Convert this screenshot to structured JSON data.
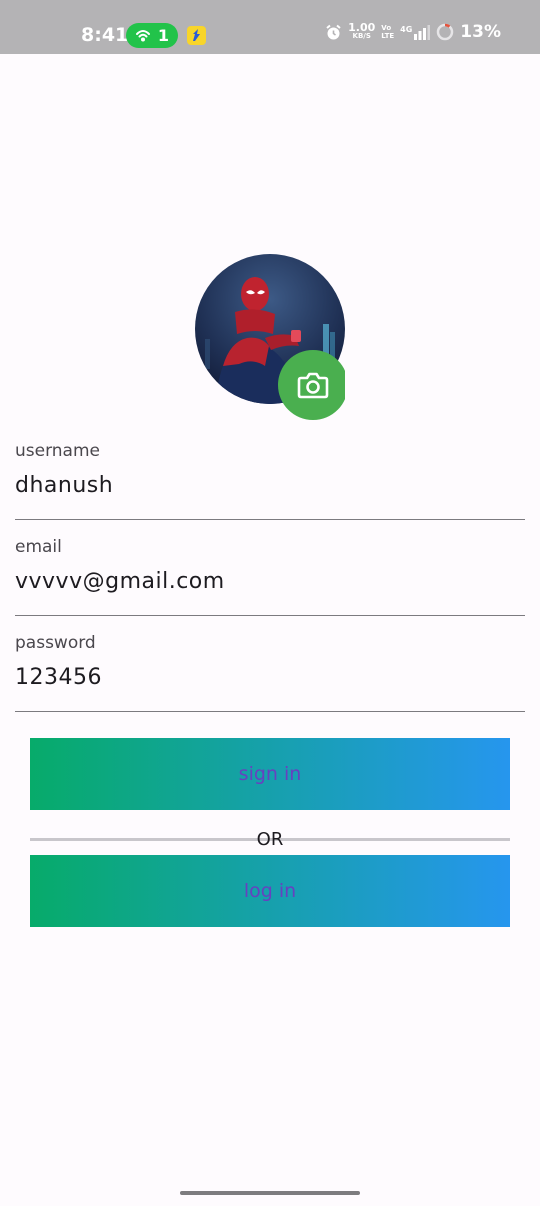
{
  "status_bar": {
    "time": "8:41",
    "hotspot_count": "1",
    "net_speed_value": "1.00",
    "net_speed_unit": "KB/S",
    "volte_top": "Vo",
    "volte_bottom": "LTE",
    "network_type": "4G",
    "battery_percent": "13%",
    "icons": [
      "hotspot-icon",
      "flipkart-app-icon",
      "alarm-icon",
      "signal-icon",
      "battery-charging-icon"
    ]
  },
  "profile": {
    "avatar": "spider-man-avatar",
    "camera_icon": "camera-icon"
  },
  "form": {
    "username_label": "username",
    "username_value": "dhanush",
    "email_label": "email",
    "email_value": "vvvvv@gmail.com",
    "password_label": "password",
    "password_value": "123456"
  },
  "actions": {
    "sign_in_label": "sign in",
    "or_text": "OR",
    "log_in_label": "log in"
  },
  "colors": {
    "accent_green": "#4aaf4f",
    "gradient_start": "#07ab6a",
    "gradient_end": "#2696ee",
    "button_text": "#6741c0"
  }
}
